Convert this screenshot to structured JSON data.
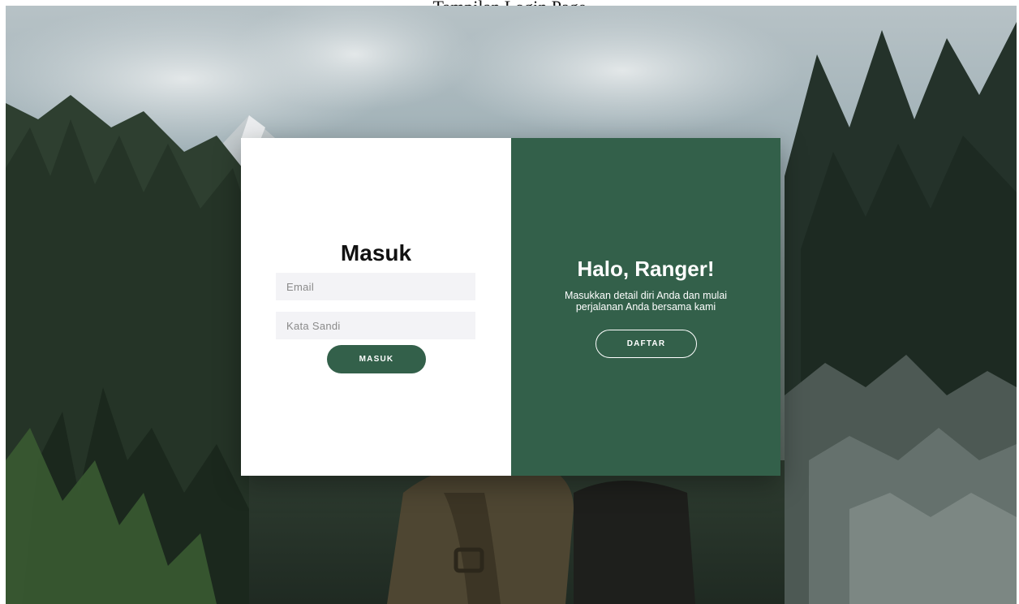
{
  "page": {
    "caption": "Tampilan Login Page"
  },
  "login": {
    "title": "Masuk",
    "email_placeholder": "Email",
    "email_value": "",
    "password_placeholder": "Kata Sandi",
    "password_value": "",
    "submit_label": "MASUK"
  },
  "welcome": {
    "title": "Halo, Ranger!",
    "text": "Masukkan detail diri Anda dan mulai perjalanan Anda bersama kami",
    "register_label": "DAFTAR"
  },
  "colors": {
    "brand_green": "#33604a",
    "input_bg": "#f3f3f6",
    "card_bg": "#ffffff"
  },
  "background": {
    "icon": "forest-mountain-photo"
  }
}
